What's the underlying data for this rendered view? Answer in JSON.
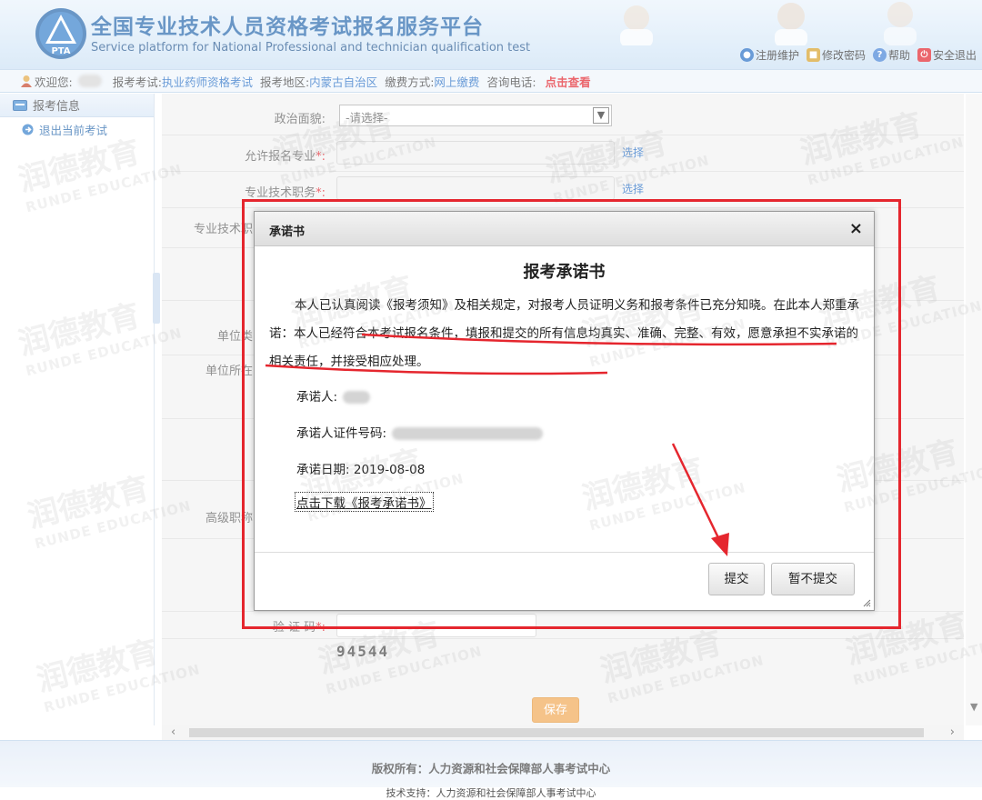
{
  "header": {
    "title": "全国专业技术人员资格考试报名服务平台",
    "subtitle": "Service platform for National Professional and technician qualification test",
    "logo_text": "PTA",
    "links": [
      {
        "label": "注册维护",
        "icon": "globe-icon",
        "color": "#1a66c2"
      },
      {
        "label": "修改密码",
        "icon": "lock-icon",
        "color": "#d49a1a"
      },
      {
        "label": "帮助",
        "icon": "help-icon",
        "color": "#3a7bd5"
      },
      {
        "label": "安全退出",
        "icon": "power-icon",
        "color": "#e0141e"
      }
    ]
  },
  "infobar": {
    "welcome_label": "欢迎您:",
    "exam_label": "报考考试:",
    "exam_value": "执业药师资格考试",
    "region_label": "报考地区:",
    "region_value": "内蒙古自治区",
    "payment_label": "缴费方式:",
    "payment_value": "网上缴费",
    "phone_label": "咨询电话:",
    "phone_link": "点击查看"
  },
  "sidebar": {
    "header": "报考信息",
    "items": [
      {
        "label": "退出当前考试"
      }
    ]
  },
  "form": {
    "political_label": "政治面貌:",
    "political_value": "-请选择-",
    "allowed_major_label": "允许报名专业",
    "professional_title_label": "专业技术职务",
    "professional_cut_label": "专业技术职",
    "unit_type_label": "单位类",
    "unit_location_label": "单位所在",
    "senior_title_label": "高级职称",
    "captcha_label": "验 证 码",
    "captcha_value": "94544",
    "select_link": "选择",
    "required_mark": "*:",
    "save_label": "保存"
  },
  "footer": {
    "copyright": "版权所有：人力资源和社会保障部人事考试中心",
    "line2": "技术支持：人力资源和社会保障部人事考试中心"
  },
  "dialog": {
    "title": "承诺书",
    "close": "×",
    "doc_title": "报考承诺书",
    "para_part1": "本人已认真阅读《报考须知》及相关规定，对报考人员证明义务和报考条件已充分知晓。在此本人郑重承诺：",
    "para_part2": "本人已经符合本考试报名条件，填报和提交的所有信息均真实、准确、完整、有效，愿意承担不实承诺的相关责任，并接受相应处理。",
    "signer_label": "承诺人:",
    "id_label": "承诺人证件号码:",
    "date_label": "承诺日期:",
    "date_value": "2019-08-08",
    "download_label": "点击下载《报考承诺书》",
    "submit_label": "提交",
    "later_label": "暂不提交"
  },
  "watermark": {
    "cn": "润德教育",
    "en": "RUNDE EDUCATION"
  },
  "colors": {
    "annotation": "#e5262e",
    "link": "#1a66c2",
    "brand": "#1a5fa8",
    "save": "#f0a44b"
  }
}
